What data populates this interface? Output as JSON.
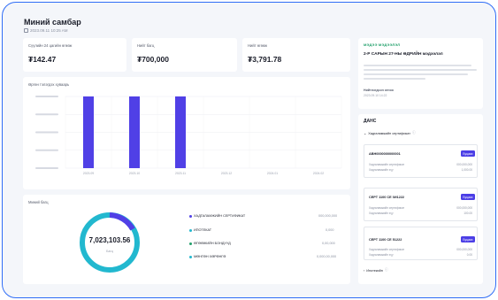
{
  "header": {
    "title": "Миний самбар",
    "date": "2023.09.11 10:25 AM"
  },
  "stats": [
    {
      "label": "Сүүлийн 24 цагийн өгөөж",
      "value": "₮142.47"
    },
    {
      "label": "Нийт багц",
      "value": "₮700,000"
    },
    {
      "label": "Нийт өгөөж",
      "value": "₮3,791.78"
    }
  ],
  "chart_data": {
    "type": "bar",
    "title": "Өргөн тэлэгдэх хуваарь",
    "categories": [
      "2023.09",
      "2023.10",
      "2023.11",
      "2023.12",
      "2024.01",
      "2024.02"
    ],
    "values": [
      1,
      1,
      1,
      0,
      0,
      0
    ],
    "ylim": [
      0,
      1
    ],
    "bar_color": "#5040e6"
  },
  "portfolio": {
    "title": "Миний багц",
    "total": "7,023,103.56",
    "total_sub": "Багц",
    "donut_color": "#22b8cf",
    "donut_accent": "#5040e6",
    "items": [
      {
        "label": "ХАДГАЛАМЖИЙН СЕРТИФИКАТ",
        "value": "000,000,000",
        "color": "#5040e6"
      },
      {
        "label": "ИПОТЕКАТ",
        "value": "0,000",
        "color": "#22b8cf"
      },
      {
        "label": "ӨГӨӨЖИЙН БОНДУУД",
        "value": "0,00,000",
        "color": "#22a06b"
      },
      {
        "label": "МӨНГӨН ХӨРӨНГӨ",
        "value": "0,000,00,000",
        "color": "#22b8cf"
      }
    ]
  },
  "announcement": {
    "section": "МЭДЭЭ МЭДЭЭЛЭЛ",
    "title": "2-Р САРЫН 27-НЫ ӨДРИЙН мэдээлэл",
    "date_label": "Нийтлэгдсэн огноо",
    "date": "2023.09.10 14:22"
  },
  "accounts": {
    "title": "ДАНС",
    "group1": "Хадгаламжийн сертификат",
    "cards": [
      {
        "name": "АВН0000000000001",
        "button": "Буцаах",
        "row1_label": "Хадгаламжийн сертификат",
        "row1_value": "000,000,000",
        "row2_label": "Хадгаламжийн хүү",
        "row2_value": "1,000.00"
      },
      {
        "name": "СЕРТ 1100 СЕ 0И1222",
        "button": "Буцаах",
        "row1_label": "Хадгаламжийн сертификат",
        "row1_value": "000,000,000",
        "row2_label": "Хадгаламжийн хүү",
        "row2_value": "100.00"
      },
      {
        "name": "СЕРТ 1100 СЕ 51222",
        "button": "Буцаах",
        "row1_label": "Хадгаламжийн сертификат",
        "row1_value": "000,000,000",
        "row2_label": "Хадгаламжийн хүү",
        "row2_value": "0.00"
      }
    ],
    "group2": "Ипотекийн"
  }
}
